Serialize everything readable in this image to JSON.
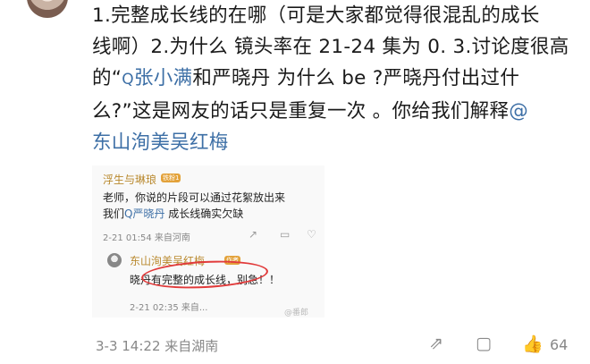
{
  "post": {
    "l1": "1.完整成长线的在哪（可是大家都觉得很混乱的成长",
    "l2": "线啊）2.为什么 镜头率在 21-24 集为 0. 3.讨论度很高",
    "l3a": "的“",
    "l3_icon": "Q",
    "l3_link": "张小满",
    "l3b": "和严晓丹 为什么 be ?严晓丹付出过什",
    "l4": "么?”这是网友的话只是重复一次 。你给我们解释",
    "l4_mention": "@",
    "l5_mention": "东山洵美吴红梅"
  },
  "embed": {
    "c1": {
      "name": "浮生与琳琅",
      "badge": "铁粉1",
      "line1": "老师，你说的片段可以通过花絮放出来",
      "line2_a": "我们",
      "line2_link": "Q严晓丹",
      "line2_b": " 成长线确实欠缺",
      "meta": "2-21 01:54  来自河南"
    },
    "c2": {
      "name": "东山洵美吴红梅",
      "badge": "作者",
      "text": "晓丹有完整的成长线，别急！！",
      "meta": "2-21 02:35  来自..."
    },
    "watermark": "@番郎"
  },
  "footer": {
    "meta": "3-3 14:22  来自湖南",
    "like_count": "64"
  },
  "icons": [
    "share-icon",
    "comment-icon",
    "like-icon"
  ],
  "colors": {
    "link": "#3d6fa6",
    "annotation": "#e13a3a"
  }
}
